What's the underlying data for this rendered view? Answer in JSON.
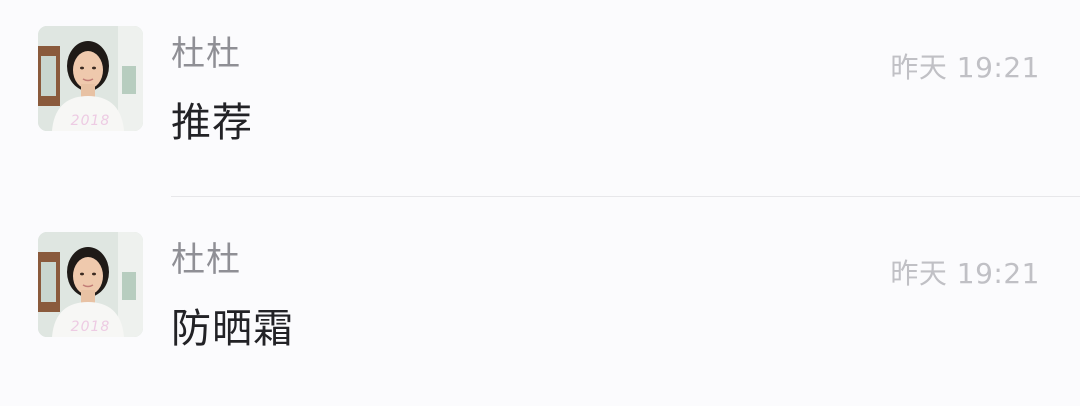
{
  "messages": [
    {
      "sender": "杜杜",
      "time": "昨天 19:21",
      "content": "推荐",
      "avatar_caption": "2018"
    },
    {
      "sender": "杜杜",
      "time": "昨天 19:21",
      "content": "防晒霜",
      "avatar_caption": "2018"
    }
  ]
}
